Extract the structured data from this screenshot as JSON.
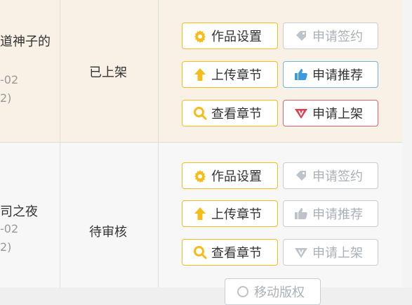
{
  "rows": [
    {
      "title_fragment": "道神子的",
      "date_fragment": "-02",
      "count_fragment": "2)",
      "status": "已上架",
      "buttons": [
        {
          "label": "作品设置",
          "icon": "gear-icon",
          "style": "yellow"
        },
        {
          "label": "申请签约",
          "icon": "tag-icon",
          "style": "gray"
        },
        {
          "label": "上传章节",
          "icon": "arrow-up-icon",
          "style": "yellow"
        },
        {
          "label": "申请推荐",
          "icon": "thumbs-up-icon",
          "style": "blue"
        },
        {
          "label": "查看章节",
          "icon": "search-icon",
          "style": "yellow"
        },
        {
          "label": "申请上架",
          "icon": "v-badge-icon",
          "style": "red"
        }
      ]
    },
    {
      "title_fragment": "司之夜",
      "date_fragment": "-02",
      "count_fragment": "2)",
      "status": "待审核",
      "buttons": [
        {
          "label": "作品设置",
          "icon": "gear-icon",
          "style": "yellow"
        },
        {
          "label": "申请签约",
          "icon": "tag-icon",
          "style": "gray"
        },
        {
          "label": "上传章节",
          "icon": "arrow-up-icon",
          "style": "yellow"
        },
        {
          "label": "申请推荐",
          "icon": "thumbs-up-icon",
          "style": "gray"
        },
        {
          "label": "查看章节",
          "icon": "search-icon",
          "style": "yellow"
        },
        {
          "label": "申请上架",
          "icon": "v-badge-icon",
          "style": "gray"
        }
      ],
      "partial_button_label": "移动版权"
    }
  ],
  "colors": {
    "yellow": "#f5bd19",
    "gray": "#c8cdd2",
    "blue": "#3c9be0",
    "red": "#d9424f",
    "row1_bg": "#f9f1e5"
  }
}
